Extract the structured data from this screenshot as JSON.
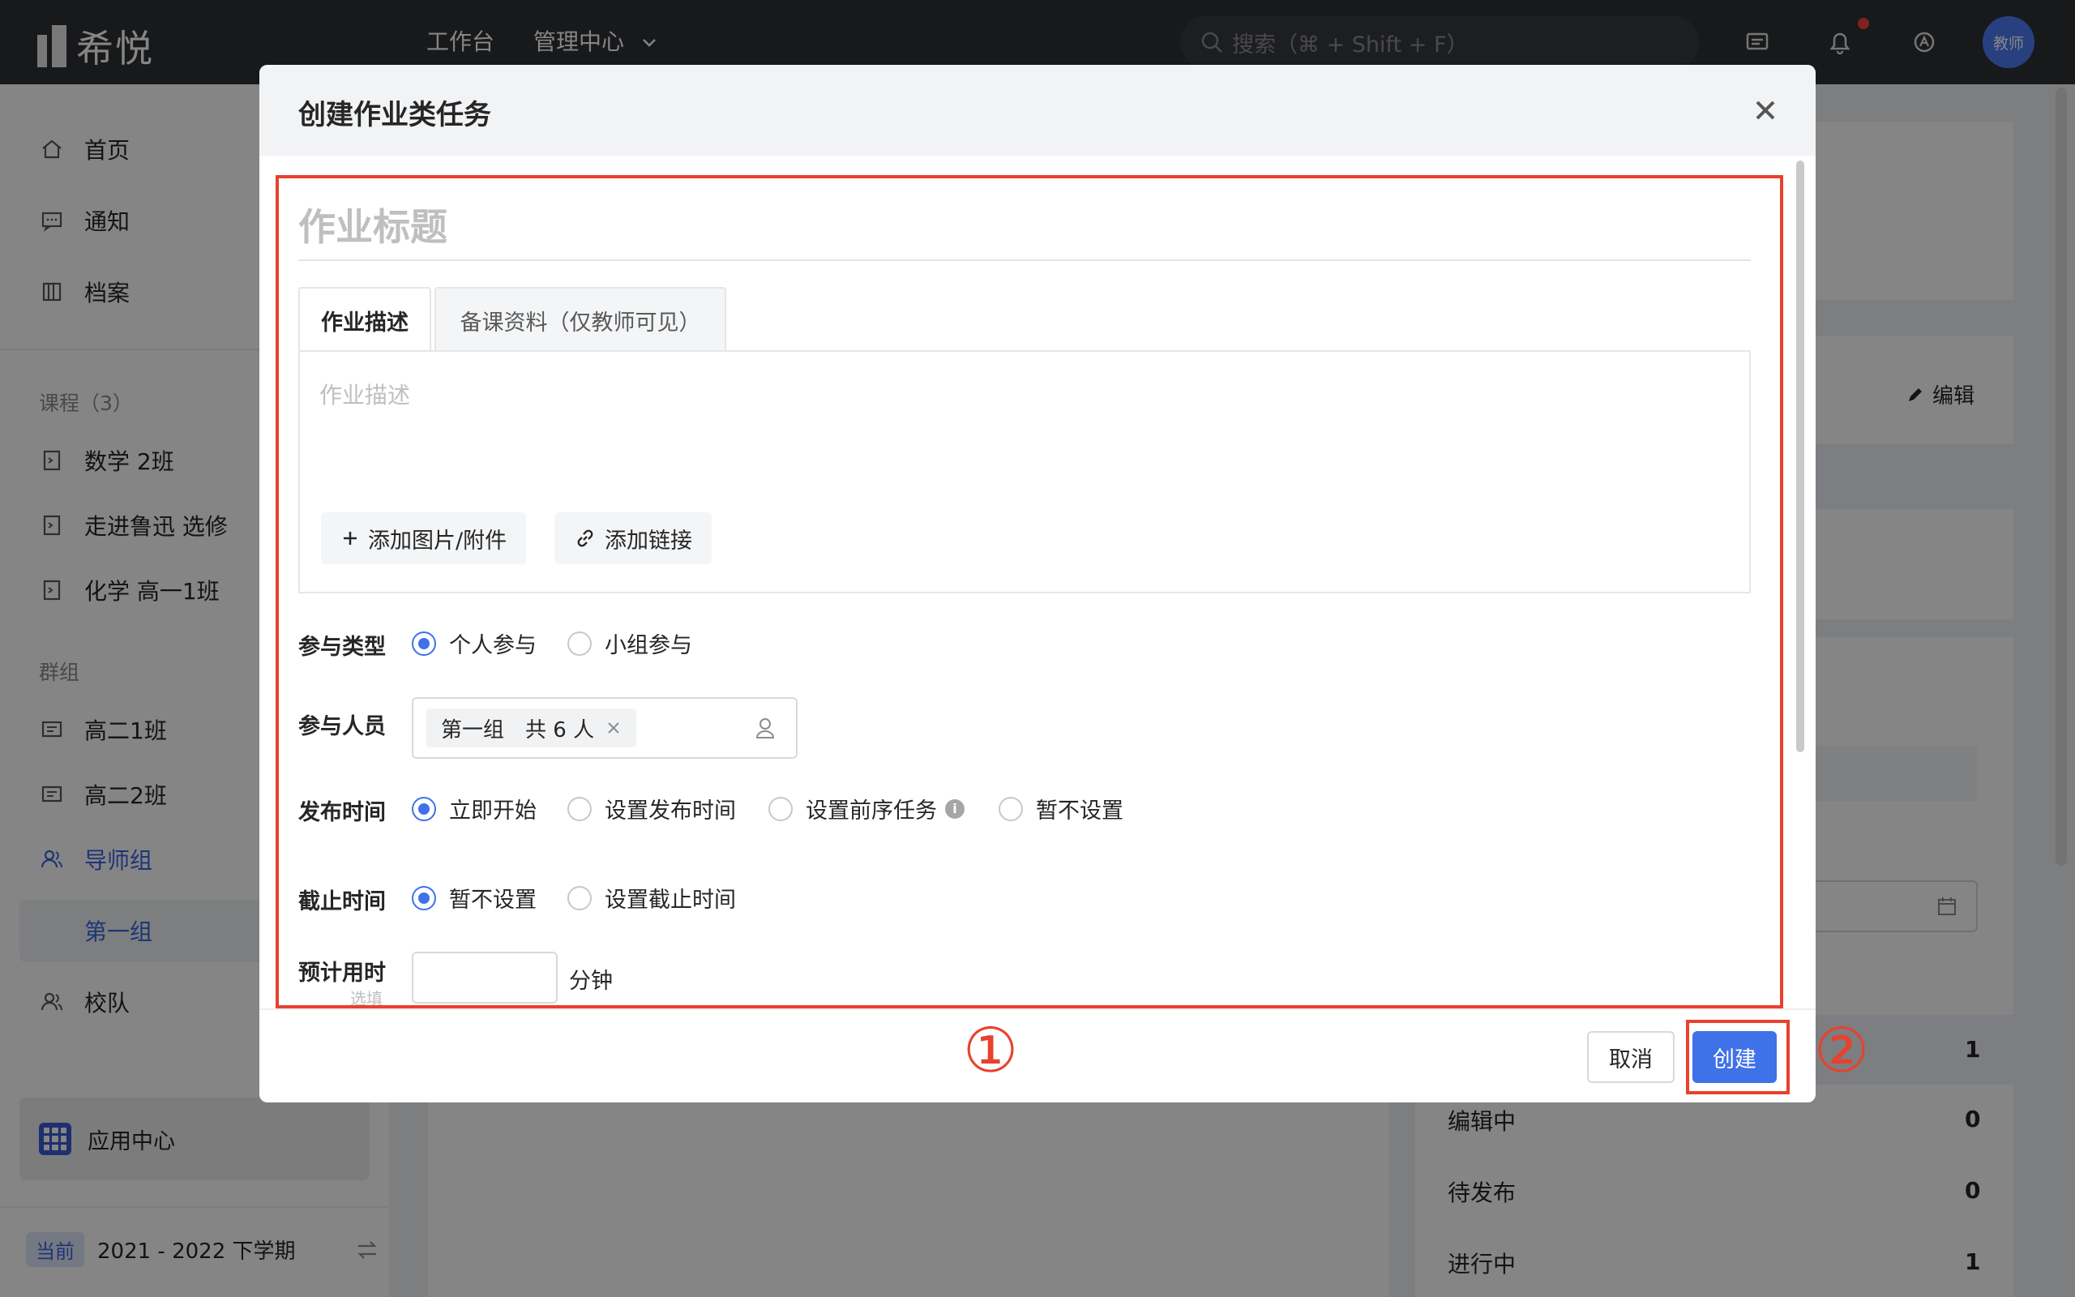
{
  "app": {
    "logo_text": "希悦"
  },
  "topbar": {
    "nav": [
      "工作台",
      "管理中心"
    ],
    "search_placeholder": "搜索（⌘ + Shift + F）",
    "avatar_text": "教师"
  },
  "sidebar": {
    "items": [
      "首页",
      "通知",
      "档案"
    ],
    "courses_title": "课程（3）",
    "courses": [
      "数学 2班",
      "走进鲁迅 选修",
      "化学 高一1班"
    ],
    "groups_title": "群组",
    "groups": [
      "高二1班",
      "高二2班",
      "导师组"
    ],
    "active_subgroup": "第一组",
    "team": "校队",
    "app_center": "应用中心",
    "term_badge": "当前",
    "term": "2021 - 2022 下学期"
  },
  "background": {
    "edit_label": "编辑",
    "stats": [
      {
        "label": "",
        "value": "1"
      },
      {
        "label": "编辑中",
        "value": "0"
      },
      {
        "label": "待发布",
        "value": "0"
      },
      {
        "label": "进行中",
        "value": "1"
      }
    ]
  },
  "modal": {
    "title": "创建作业类任务",
    "title_placeholder": "作业标题",
    "tabs": [
      "作业描述",
      "备课资料（仅教师可见）"
    ],
    "desc_placeholder": "作业描述",
    "add_attachment": "添加图片/附件",
    "add_link": "添加链接",
    "participation_type": {
      "label": "参与类型",
      "options": [
        "个人参与",
        "小组参与"
      ],
      "selected": "个人参与"
    },
    "participants": {
      "label": "参与人员",
      "tag": "第一组　共 6 人"
    },
    "publish_time": {
      "label": "发布时间",
      "options": [
        "立即开始",
        "设置发布时间",
        "设置前序任务",
        "暂不设置"
      ],
      "selected": "立即开始"
    },
    "deadline": {
      "label": "截止时间",
      "options": [
        "暂不设置",
        "设置截止时间"
      ],
      "selected": "暂不设置"
    },
    "estimated_time": {
      "label": "预计用时",
      "sublabel": "选填",
      "unit": "分钟"
    },
    "cancel": "取消",
    "create": "创建"
  },
  "annotations": {
    "one": "①",
    "two": "②",
    "color": "#e8412e"
  }
}
